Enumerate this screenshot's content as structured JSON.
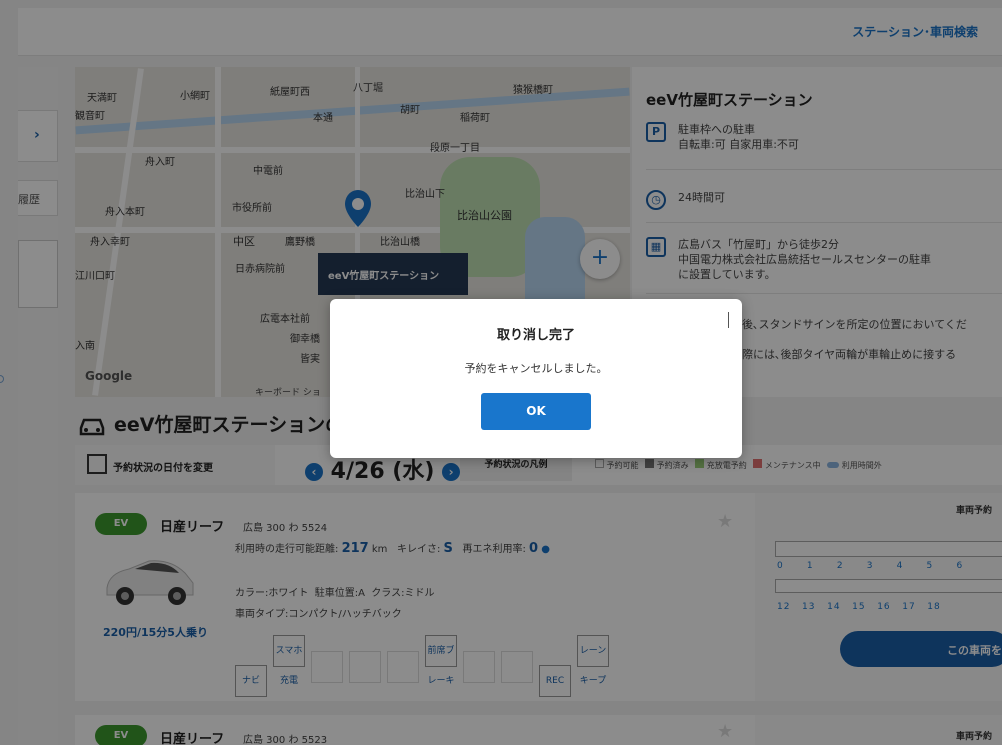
{
  "header": {
    "nav_link": "ステーション･車両検索"
  },
  "sidebar": {
    "history_label": "履歴",
    "expand_icon": "chevron-right-icon"
  },
  "map": {
    "labels": [
      "天満町",
      "小網町",
      "紙屋町西",
      "八丁堀",
      "本通",
      "胡町",
      "稲荷町",
      "猿猴橋町",
      "舟入町",
      "中電前",
      "段原一丁目",
      "舟入本町",
      "市役所前",
      "比治山下",
      "比治山公園",
      "舟入幸町",
      "中区",
      "鷹野橋",
      "比治山橋",
      "日赤病院前",
      "江川口町",
      "広電本社前",
      "御幸橋",
      "皆実",
      "入南",
      "観音町"
    ],
    "pin_label": "eeV竹屋町ステーション",
    "zoom_in": "+",
    "google_logo": "Google",
    "keyboard_shortcuts": "キーボード ショ"
  },
  "station": {
    "title": "eeV竹屋町ステーション",
    "parking_title": "駐車枠への駐車",
    "parking_detail": "自転車:可 自家用車:不可",
    "hours": "24時間可",
    "access_line1": "広島バス「竹屋町」から徒歩2分",
    "access_line2": "中国電力株式会社広島統括セールスセンターの駐車",
    "access_line3": "に設置しています。",
    "note_line1": "後､スタンドサインを所定の位置においてくだ",
    "note_line2": "際には､後部タイヤ両輪が車輪止めに接する"
  },
  "section": {
    "title": "eeV竹屋町ステーションの",
    "change_date": "予約状況の日付を変更",
    "date": "4/26 (水)",
    "legend_label": "予約状況の凡例",
    "legend_items": [
      "予約可能",
      "予約済み",
      "充放電予約",
      "メンテナンス中",
      "利用時間外"
    ]
  },
  "cars": [
    {
      "badge": "EV",
      "name": "日産リーフ",
      "plate": "広島 300 わ 5524",
      "range_label": "利用時の走行可能距離:",
      "range_value": "217",
      "range_unit": "km",
      "clean_label": "キレイさ:",
      "clean_value": "S",
      "renew_label": "再エネ利用率:",
      "renew_value": "0",
      "color": "カラー:ホワイト",
      "parking_pos": "駐車位置:A",
      "class": "クラス:ミドル",
      "type": "車両タイプ:コンパクト/ハッチバック",
      "price": "220円/15分",
      "capacity": "5人乗り",
      "features": [
        "ナビ",
        "スマホ充電",
        "",
        "",
        "",
        "前席ブレーキ",
        "",
        "",
        "REC",
        "レーンキープ"
      ],
      "reserve_title": "車両予約",
      "ticks_top": [
        "0",
        "1",
        "2",
        "3",
        "4",
        "5",
        "6"
      ],
      "ticks_bottom": [
        "12",
        "13",
        "14",
        "15",
        "16",
        "17",
        "18"
      ],
      "book_button": "この車両を"
    },
    {
      "badge": "EV",
      "name": "日産リーフ",
      "plate": "広島 300 わ 5523",
      "reserve_title": "車両予約"
    }
  ],
  "modal": {
    "title": "取り消し完了",
    "message": "予約をキャンセルしました。",
    "ok_button": "OK"
  }
}
